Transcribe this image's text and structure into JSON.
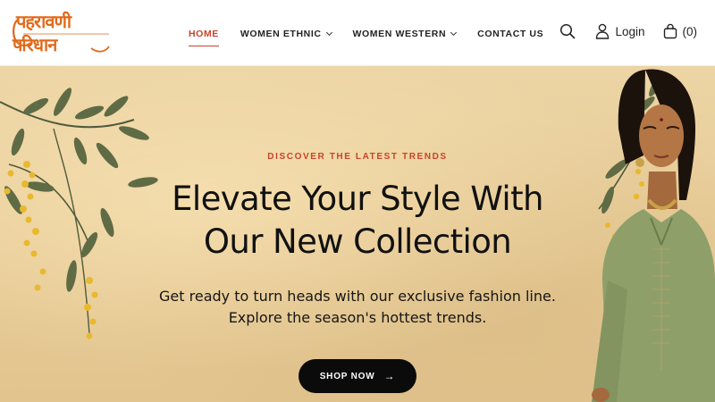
{
  "brand": {
    "logo_line1": "पहरावणी",
    "logo_line2": "परिधान"
  },
  "nav": {
    "items": [
      {
        "label": "HOME",
        "active": true,
        "dropdown": false
      },
      {
        "label": "WOMEN ETHNIC",
        "active": false,
        "dropdown": true
      },
      {
        "label": "WOMEN WESTERN",
        "active": false,
        "dropdown": true
      },
      {
        "label": "CONTACT US",
        "active": false,
        "dropdown": false
      }
    ]
  },
  "tools": {
    "login_label": "Login",
    "cart_count": "(0)",
    "icons": [
      "search-icon",
      "user-icon",
      "bag-icon"
    ]
  },
  "hero": {
    "eyebrow": "DISCOVER THE LATEST TRENDS",
    "headline_line1": "Elevate Your Style With",
    "headline_line2": "Our New Collection",
    "sub_line1": "Get ready to turn heads with our exclusive fashion line.",
    "sub_line2": "Explore the season's hottest trends.",
    "cta_label": "SHOP NOW",
    "cta_icon": "arrow-right-icon"
  },
  "colors": {
    "accent": "#c8432b",
    "logo": "#e06a1b",
    "hero_bg": "#e7cc98",
    "cta_bg": "#0b0b0b"
  }
}
